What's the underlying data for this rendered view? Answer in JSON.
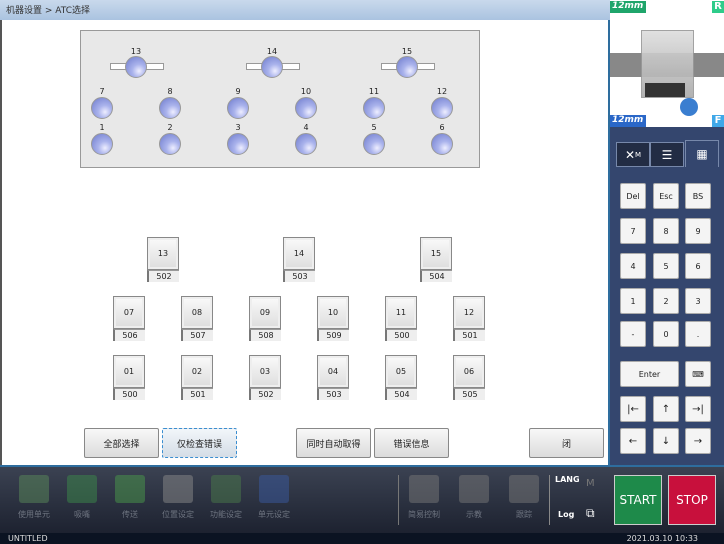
{
  "title": "机器设置 > ATC选择",
  "nozzle_map": {
    "top": [
      "13",
      "14",
      "15"
    ],
    "mid": [
      "7",
      "8",
      "9",
      "10",
      "11",
      "12"
    ],
    "bot": [
      "1",
      "2",
      "3",
      "4",
      "5",
      "6"
    ]
  },
  "holders": {
    "top": [
      {
        "id": "13",
        "val": "502"
      },
      {
        "id": "14",
        "val": "503"
      },
      {
        "id": "15",
        "val": "504"
      }
    ],
    "mid": [
      {
        "id": "07",
        "val": "506"
      },
      {
        "id": "08",
        "val": "507"
      },
      {
        "id": "09",
        "val": "508"
      },
      {
        "id": "10",
        "val": "509"
      },
      {
        "id": "11",
        "val": "500"
      },
      {
        "id": "12",
        "val": "501"
      }
    ],
    "bot": [
      {
        "id": "01",
        "val": "500"
      },
      {
        "id": "02",
        "val": "501"
      },
      {
        "id": "03",
        "val": "502"
      },
      {
        "id": "04",
        "val": "503"
      },
      {
        "id": "05",
        "val": "504"
      },
      {
        "id": "06",
        "val": "505"
      }
    ]
  },
  "buttons": {
    "select_all": "全部选择",
    "check_errors": "仅检查错误",
    "auto_get": "同时自动取得",
    "error_info": "错误信息",
    "close": "闭"
  },
  "machine": {
    "rear_width": "12mm",
    "front_width": "12mm",
    "rear": "R",
    "front": "F"
  },
  "keypad": {
    "rows": [
      [
        "Del",
        "Esc",
        "BS"
      ],
      [
        "7",
        "8",
        "9"
      ],
      [
        "4",
        "5",
        "6"
      ],
      [
        "1",
        "2",
        "3"
      ],
      [
        "-",
        "0",
        "."
      ]
    ],
    "enter": "Enter",
    "nav": [
      [
        "|←",
        "↑",
        "→|"
      ],
      [
        "←",
        "↓",
        "→"
      ]
    ]
  },
  "bottom": {
    "items": [
      "使用单元",
      "吸嘴",
      "传送",
      "位置设定",
      "功能设定",
      "单元设定"
    ],
    "items2": [
      "简易控制",
      "示教",
      "跟踪"
    ],
    "lang": "LANG",
    "log": "Log",
    "m": "M",
    "start": "START",
    "stop": "STOP"
  },
  "status": {
    "file": "UNTITLED",
    "datetime": "2021.03.10 10:33"
  },
  "colors": {
    "start": "#1e8a4a",
    "stop": "#c8103c",
    "accent": "#2e6d9e"
  }
}
